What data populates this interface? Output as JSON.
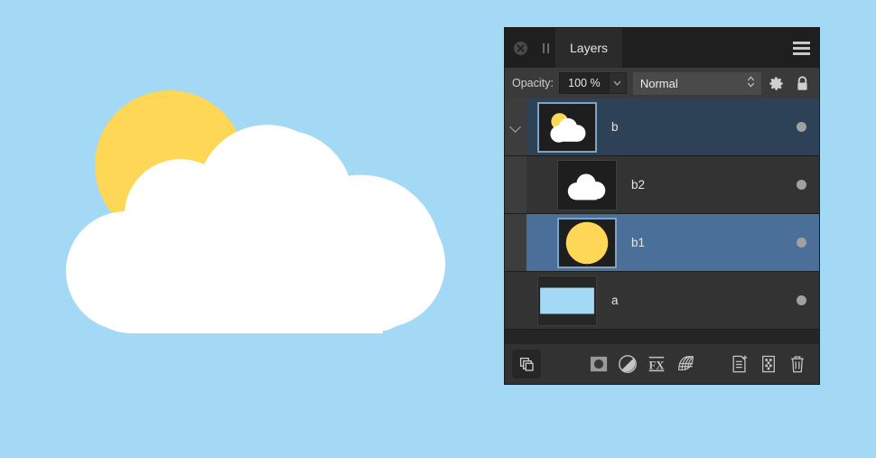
{
  "canvas": {
    "background_color": "#a3d9f5",
    "illustration": {
      "name": "sun-behind-cloud",
      "sun_color": "#fdd755",
      "cloud_color": "#ffffff"
    }
  },
  "panel": {
    "titlebar": {
      "close_icon": "close-circle-icon",
      "grip_icon": "drag-grip-icon",
      "tab_label": "Layers",
      "menu_icon": "hamburger-menu-icon"
    },
    "options": {
      "opacity_label": "Opacity:",
      "opacity_value": "100 %",
      "opacity_stepper_icon": "chevron-down-icon",
      "blend_mode": "Normal",
      "blend_stepper_icon": "up-down-arrows-icon",
      "settings_icon": "gear-icon",
      "lock_icon": "lock-closed-icon"
    },
    "layers": [
      {
        "name": "b",
        "thumbnail": "sun-behind-cloud-thumb",
        "selected": true,
        "selection_style": "dark",
        "is_group": true,
        "expanded": true,
        "indent": 0,
        "dot": "visibility-dot"
      },
      {
        "name": "b2",
        "thumbnail": "cloud-thumb",
        "selected": false,
        "selection_style": "plain",
        "is_group": false,
        "expanded": false,
        "indent": 1,
        "dot": "visibility-dot"
      },
      {
        "name": "b1",
        "thumbnail": "sun-circle-thumb",
        "selected": true,
        "selection_style": "bright",
        "is_group": false,
        "expanded": false,
        "indent": 1,
        "dot": "visibility-dot"
      },
      {
        "name": "a",
        "thumbnail": "blue-rectangle-thumb",
        "selected": false,
        "selection_style": "plain",
        "is_group": false,
        "expanded": false,
        "indent": 0,
        "dot": "visibility-dot"
      }
    ],
    "footer": {
      "left": [
        {
          "icon": "layer-stack-icon",
          "label": "Link layers",
          "boxed": true
        }
      ],
      "middle": [
        {
          "icon": "layer-mask-icon",
          "label": "Add layer mask"
        },
        {
          "icon": "adjustment-layer-icon",
          "label": "Add adjustment layer"
        },
        {
          "icon": "fx-effects-icon",
          "label": "Add layer effects"
        },
        {
          "icon": "layer-style-icon",
          "label": "Layer styles"
        }
      ],
      "right": [
        {
          "icon": "new-layer-icon",
          "label": "New layer"
        },
        {
          "icon": "new-group-icon",
          "label": "New group"
        },
        {
          "icon": "trash-icon",
          "label": "Delete layer"
        }
      ]
    },
    "colors": {
      "panel_bg": "#2b2b2b",
      "titlebar_bg": "#1f1f1f",
      "row_bg": "#333333",
      "selected_dark": "#2e4257",
      "selected_bright": "#4a6f99",
      "text": "#e6e6e6"
    }
  }
}
